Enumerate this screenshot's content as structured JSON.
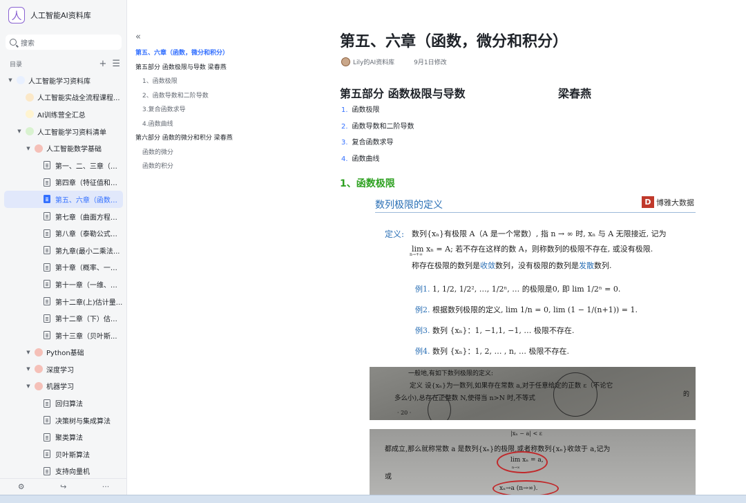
{
  "sidebar": {
    "brand_logo_glyph": "人",
    "brand_name": "人工智能AI资料库",
    "search_placeholder": "搜索",
    "toc_label": "目录",
    "items": [
      {
        "label": "人工智能学习资料库",
        "level": 0,
        "icon": "node-icon",
        "color": "#e8f0ff"
      },
      {
        "label": "人工智能实战全流程课程...",
        "level": 1,
        "icon": "node-icon",
        "color": "#fbe8c8"
      },
      {
        "label": "AI训练营全汇总",
        "level": 1,
        "icon": "node-icon",
        "color": "#fff4d0"
      },
      {
        "label": "人工智能学习资料清单",
        "level": 1,
        "icon": "node-icon",
        "color": "#d9f2d0"
      },
      {
        "label": "人工智能数学基础",
        "level": 2,
        "icon": "node-icon",
        "color": "#f5c0b8"
      },
      {
        "label": "第一、二、三章（向...",
        "level": 3,
        "icon": "doc-icon"
      },
      {
        "label": "第四章（特征值和特...",
        "level": 3,
        "icon": "doc-icon"
      },
      {
        "label": "第五、六章（函数，...",
        "level": 3,
        "icon": "doc-icon",
        "active": true
      },
      {
        "label": "第七章（曲面方程、...",
        "level": 3,
        "icon": "doc-icon"
      },
      {
        "label": "第八章（泰勒公式、...",
        "level": 3,
        "icon": "doc-icon"
      },
      {
        "label": "第九章(最小二乘法...",
        "level": 3,
        "icon": "doc-icon"
      },
      {
        "label": "第十章（概率、一维...",
        "level": 3,
        "icon": "doc-icon"
      },
      {
        "label": "第十一章（一维、二...",
        "level": 3,
        "icon": "doc-icon"
      },
      {
        "label": "第十二章(上)估计量...",
        "level": 3,
        "icon": "doc-icon"
      },
      {
        "label": "第十二章（下）估计...",
        "level": 3,
        "icon": "doc-icon"
      },
      {
        "label": "第十三章（贝叶斯...",
        "level": 3,
        "icon": "doc-icon"
      },
      {
        "label": "Python基础",
        "level": 2,
        "icon": "node-icon",
        "color": "#f5c0b8"
      },
      {
        "label": "深度学习",
        "level": 2,
        "icon": "node-icon",
        "color": "#f5c0b8"
      },
      {
        "label": "机器学习",
        "level": 2,
        "icon": "node-icon",
        "color": "#f5c0b8"
      },
      {
        "label": "回归算法",
        "level": 3,
        "icon": "doc-icon"
      },
      {
        "label": "决策树与集成算法",
        "level": 3,
        "icon": "doc-icon"
      },
      {
        "label": "聚类算法",
        "level": 3,
        "icon": "doc-icon"
      },
      {
        "label": "贝叶斯算法",
        "level": 3,
        "icon": "doc-icon"
      },
      {
        "label": "支持向量机",
        "level": 3,
        "icon": "doc-icon"
      }
    ],
    "bottom": {
      "settings": "⚙",
      "share": "↪",
      "more": "···"
    }
  },
  "outline": {
    "collapse_glyph": "«",
    "items": [
      {
        "label": "第五、六章（函数，微分和积分）",
        "level": 1,
        "active": true
      },
      {
        "label": "第五部分 函数极限与导数 梁春燕",
        "level": 1
      },
      {
        "label": "1、函数极限",
        "level": 2
      },
      {
        "label": "2、函数导数和二阶导数",
        "level": 2
      },
      {
        "label": "3.复合函数求导",
        "level": 2
      },
      {
        "label": "4.函数曲线",
        "level": 2
      },
      {
        "label": "第六部分 函数的微分和积分 梁春燕",
        "level": 1
      },
      {
        "label": "函数的微分",
        "level": 2
      },
      {
        "label": "函数的积分",
        "level": 2
      }
    ]
  },
  "doc": {
    "title": "第五、六章（函数，微分和积分）",
    "author": "Lily的AI资料库",
    "modified": "9月1日修改",
    "section_title": "第五部分 函数极限与导数",
    "section_author": "梁春燕",
    "list": [
      {
        "num": "1.",
        "text": "函数极限"
      },
      {
        "num": "2.",
        "text": "函数导数和二阶导数"
      },
      {
        "num": "3.",
        "text": "复合函数求导"
      },
      {
        "num": "4.",
        "text": "函数曲线"
      }
    ],
    "subheading": "1、函数极限",
    "slide": {
      "title": "数列极限的定义",
      "logo_mark": "D",
      "logo_text": "博雅大数据",
      "def_kw": "定义:",
      "def_line1": "数列{xₙ}有极限 A（A 是一个常数）, 指 n → ∞ 时, xₙ 与 A 无限接近, 记为",
      "def_line2": "lim xₙ = A; 若不存在这样的数 A，则称数列的极限不存在, 或没有极限.",
      "def_line2_sub": "n→+∞",
      "def_line3a": "称存在极限的数列是",
      "def_line3_conv": "收敛",
      "def_line3b": "数列，没有极限的数列是",
      "def_line3_div": "发散",
      "def_line3c": "数列.",
      "ex1_kw": "例1.",
      "ex1": "1, 1/2, 1/2², …, 1/2ⁿ, … 的极限是0, 即 lim 1/2ⁿ = 0.",
      "ex2_kw": "例2.",
      "ex2": "根据数列极限的定义, lim 1/n = 0, lim (1 − 1/(n+1)) = 1.",
      "ex3_kw": "例3.",
      "ex3": "数列 {xₙ}：1, −1,1, −1, … 极限不存在.",
      "ex4_kw": "例4.",
      "ex4": "数列 {xₙ}：1, 2, … , n, … 极限不存在."
    },
    "photo1": {
      "line1": "一般地,有如下数列极限的定义:",
      "line2": "定义  设{xₙ}为一数列,如果存在常数 a,对于任意给定的正数 ε（不论它",
      "line3": "多么小),总存在正整数 N,使得当 n>N 时,不等式",
      "page": "· 20 ·",
      "side": "的"
    },
    "photo2": {
      "line0": "|xₙ − a| < ε",
      "line1": "都成立,那么就称常数 a 是数列{xₙ}的极限,或者称数列{xₙ}收敛于 a,记为",
      "formula1": "lim xₙ = a,",
      "formula1_sub": "n→∞",
      "line_or": "或",
      "formula2": "xₙ→a  (n→∞)."
    }
  }
}
